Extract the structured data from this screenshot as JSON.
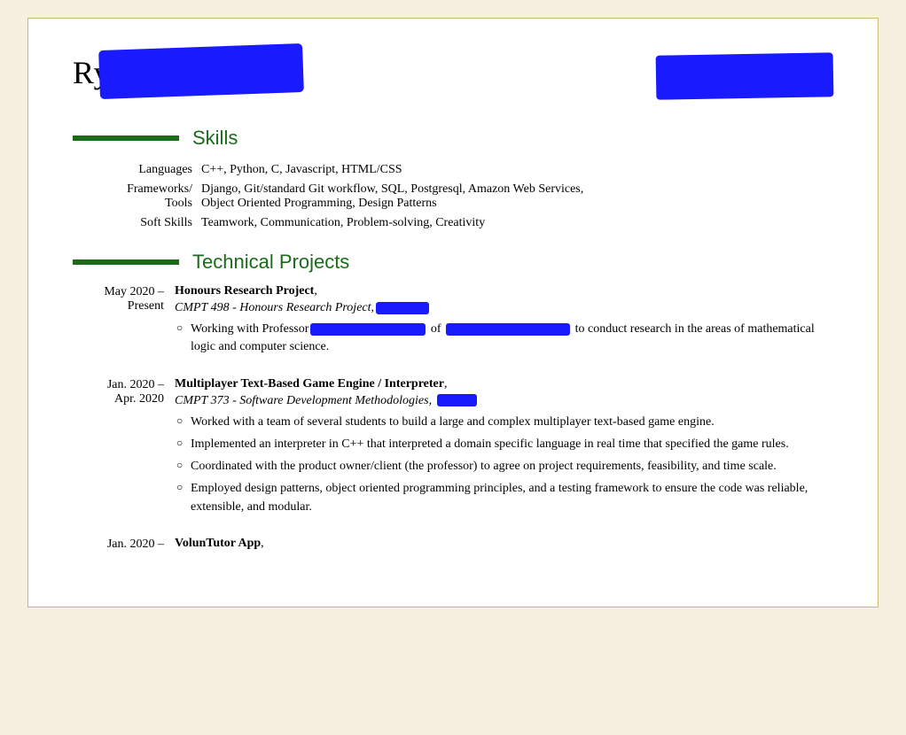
{
  "header": {
    "name_prefix": "Rya",
    "redact_name": true,
    "redact_contact": true
  },
  "skills": {
    "section_title": "Skills",
    "rows": [
      {
        "label": "Languages",
        "value": "C++, Python, C, Javascript, HTML/CSS"
      },
      {
        "label": "Frameworks/ Tools",
        "value": "Django, Git/standard Git workflow, SQL, Postgresql, Amazon Web Services, Object Oriented Programming, Design Patterns"
      },
      {
        "label": "Soft Skills",
        "value": "Teamwork, Communication, Problem-solving, Creativity"
      }
    ]
  },
  "technical_projects": {
    "section_title": "Technical Projects",
    "projects": [
      {
        "date_start": "May 2020 –",
        "date_end": "Present",
        "title": "Honours Research Project",
        "course_prefix": "CMPT 498 - Honours Research Project,",
        "course_redact_width": 60,
        "bullets": [
          "Working with Professor[REDACTED] of [REDACTED] to conduct research in the areas of mathematical logic and computer science."
        ]
      },
      {
        "date_start": "Jan. 2020 –",
        "date_end": "Apr. 2020",
        "title": "Multiplayer Text-Based Game Engine / Interpreter",
        "course_prefix": "CMPT 373 - Software Development Methodologies,",
        "course_redact_width": 45,
        "bullets": [
          "Worked with a team of several students to build a large and complex multiplayer text-based game engine.",
          "Implemented an interpreter in C++ that interpreted a domain specific language in real time that specified the game rules.",
          "Coordinated with the product owner/client (the professor) to agree on project requirements, feasibility, and time scale.",
          "Employed design patterns, object oriented programming principles, and a testing framework to ensure the code was reliable, extensible, and modular."
        ]
      },
      {
        "date_start": "Jan. 2020 –",
        "date_end": "",
        "title": "VolunTutor App",
        "course_prefix": "",
        "bullets": []
      }
    ]
  },
  "colors": {
    "green": "#1a6b1a",
    "redact_blue": "#1a1aff",
    "text": "#000000",
    "background": "#ffffff",
    "border": "#c8b97a"
  }
}
